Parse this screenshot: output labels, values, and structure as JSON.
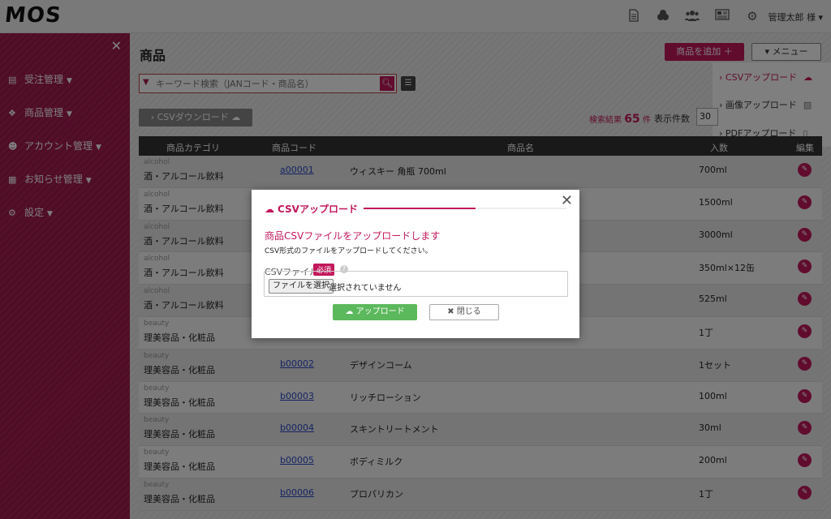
{
  "header": {
    "logo": "MOS",
    "icons": [
      "document-icon",
      "orders-icon",
      "users-icon",
      "news-icon",
      "gear-icon"
    ],
    "user": "管理太郎 様 ▾"
  },
  "sidebar": {
    "items": [
      {
        "label": "受注管理",
        "icon": "document-icon"
      },
      {
        "label": "商品管理",
        "icon": "products-icon"
      },
      {
        "label": "アカウント管理",
        "icon": "users-icon"
      },
      {
        "label": "お知らせ管理",
        "icon": "news-icon"
      },
      {
        "label": "設定",
        "icon": "gear-icon"
      }
    ]
  },
  "main": {
    "title": "商品",
    "search_placeholder": "キーワード検索（JANコード・商品名）",
    "add_button": "商品を追加 ＋",
    "menu_button": "▾ メニュー",
    "dropdown": {
      "csv_upload": "CSVアップロード",
      "image_upload": "画像アップロード",
      "pdf_upload": "PDFアップロード"
    },
    "csv_download": "CSVダウンロード",
    "result_label": "検索結果",
    "result_count": "65",
    "result_unit": "件",
    "per_page_label": "表示件数",
    "per_page_value": "30",
    "columns": {
      "category": "商品カテゴリ",
      "code": "商品コード",
      "name": "商品名",
      "qty": "入数",
      "edit": "編集"
    },
    "rows": [
      {
        "cat_en": "alcohol",
        "cat_ja": "酒・アルコール飲料",
        "code": "a00001",
        "name": "ウィスキー 角瓶 700ml",
        "qty": "700ml"
      },
      {
        "cat_en": "alcohol",
        "cat_ja": "酒・アルコール飲料",
        "code": "",
        "name": "",
        "qty": "1500ml"
      },
      {
        "cat_en": "alcohol",
        "cat_ja": "酒・アルコール飲料",
        "code": "",
        "name": "",
        "qty": "3000ml"
      },
      {
        "cat_en": "alcohol",
        "cat_ja": "酒・アルコール飲料",
        "code": "",
        "name": "",
        "qty": "350ml×12缶"
      },
      {
        "cat_en": "alcohol",
        "cat_ja": "酒・アルコール飲料",
        "code": "",
        "name": "",
        "qty": "525ml"
      },
      {
        "cat_en": "beauty",
        "cat_ja": "理美容品・化粧品",
        "code": "",
        "name": "",
        "qty": "1丁"
      },
      {
        "cat_en": "beauty",
        "cat_ja": "理美容品・化粧品",
        "code": "b00002",
        "name": "デザインコーム",
        "qty": "1セット"
      },
      {
        "cat_en": "beauty",
        "cat_ja": "理美容品・化粧品",
        "code": "b00003",
        "name": "リッチローション",
        "qty": "100ml"
      },
      {
        "cat_en": "beauty",
        "cat_ja": "理美容品・化粧品",
        "code": "b00004",
        "name": "スキントリートメント",
        "qty": "30ml"
      },
      {
        "cat_en": "beauty",
        "cat_ja": "理美容品・化粧品",
        "code": "b00005",
        "name": "ボディミルク",
        "qty": "200ml"
      },
      {
        "cat_en": "beauty",
        "cat_ja": "理美容品・化粧品",
        "code": "b00006",
        "name": "プロパリカン",
        "qty": "1丁"
      }
    ]
  },
  "modal": {
    "title": "CSVアップロード",
    "heading": "商品CSVファイルをアップロードします",
    "description": "CSV形式のファイルをアップロードしてください。",
    "file_label": "CSVファイル",
    "required": "必須",
    "help": "?",
    "choose_button": "ファイルを選択",
    "file_status": "選択されていません",
    "upload_button": "アップロード",
    "close_button": "閉じる"
  },
  "colors": {
    "brand": "#c2185b",
    "sidebar": "#a81f52",
    "upload_green": "#5cb85c"
  }
}
